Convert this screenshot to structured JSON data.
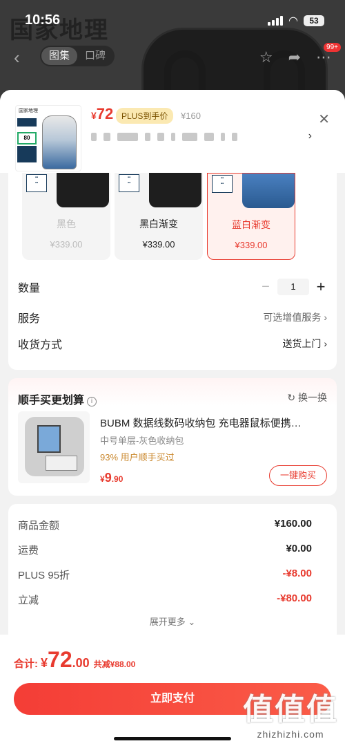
{
  "status_bar": {
    "time": "10:56",
    "battery": "53"
  },
  "background": {
    "title": "国家地理",
    "tabs": [
      {
        "label": "图集"
      },
      {
        "label": "口碑"
      }
    ],
    "cart_badge": "99+"
  },
  "sheet_header": {
    "thumb_brand": "国家地理",
    "thumb_capacity": "80",
    "price_symbol": "¥",
    "price": "72",
    "plus_tag": "PLUS到手价",
    "original_price": "¥160"
  },
  "colors": {
    "options": [
      {
        "name": "黑色",
        "price": "¥339.00",
        "state": "disabled"
      },
      {
        "name": "黑白渐变",
        "price": "¥339.00",
        "state": "normal"
      },
      {
        "name": "蓝白渐变",
        "price": "¥339.00",
        "state": "selected"
      }
    ]
  },
  "quantity": {
    "label": "数量",
    "value": "1"
  },
  "service": {
    "label": "服务",
    "value": "可选增值服务"
  },
  "delivery": {
    "label": "收货方式",
    "value": "送货上门"
  },
  "addon": {
    "title": "顺手买更划算",
    "refresh_label": "换一换",
    "product_name": "BUBM 数据线数码收纳包 充电器鼠标便携…",
    "spec": "中号单层-灰色收纳包",
    "popularity": "93% 用户顺手买过",
    "price_symbol": "¥",
    "price": "9",
    "price_decimal": ".90",
    "buy_label": "一键购买"
  },
  "summary": {
    "rows": [
      {
        "label": "商品金额",
        "value": "¥160.00",
        "red": false
      },
      {
        "label": "运费",
        "value": "¥0.00",
        "red": false
      },
      {
        "label": "PLUS 95折",
        "value": "-¥8.00",
        "red": true
      },
      {
        "label": "立减",
        "value": "-¥80.00",
        "red": true
      }
    ],
    "expand_label": "展开更多"
  },
  "footer": {
    "total_label": "合计:",
    "total_symbol": "¥",
    "total_int": "72",
    "total_dec": ".00",
    "saving": "共减¥88.00",
    "pay_label": "立即支付"
  },
  "watermark": {
    "logo": "值值值",
    "site": "zhizhizhi.com"
  },
  "accent_color": "#e83b2f"
}
